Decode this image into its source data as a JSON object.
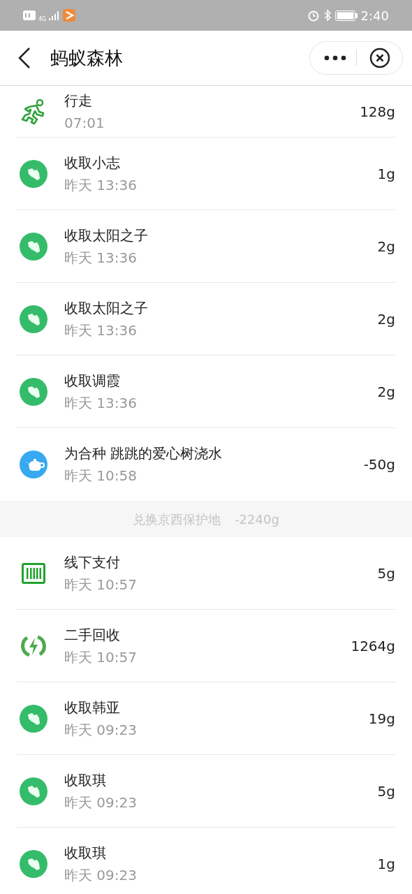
{
  "status_bar": {
    "network": "4G",
    "time": "2:40"
  },
  "header": {
    "title": "蚂蚁森林"
  },
  "records": [
    {
      "kind": "walk",
      "title": "行走",
      "time": "07:01",
      "amount": "128g"
    },
    {
      "kind": "collect",
      "title": "收取小志",
      "time": "昨天 13:36",
      "amount": "1g"
    },
    {
      "kind": "collect",
      "title": "收取太阳之子",
      "time": "昨天 13:36",
      "amount": "2g"
    },
    {
      "kind": "collect",
      "title": "收取太阳之子",
      "time": "昨天 13:36",
      "amount": "2g"
    },
    {
      "kind": "collect",
      "title": "收取调霞",
      "time": "昨天 13:36",
      "amount": "2g"
    },
    {
      "kind": "water",
      "title": "为合种 跳跳的爱心树浇水",
      "time": "昨天 10:58",
      "amount": "-50g"
    },
    {
      "kind": "separator",
      "title": "兑换京西保护地",
      "amount": "-2240g"
    },
    {
      "kind": "pay",
      "title": "线下支付",
      "time": "昨天 10:57",
      "amount": "5g"
    },
    {
      "kind": "recycle",
      "title": "二手回收",
      "time": "昨天 10:57",
      "amount": "1264g"
    },
    {
      "kind": "collect",
      "title": "收取韩亚",
      "time": "昨天 09:23",
      "amount": "19g"
    },
    {
      "kind": "collect",
      "title": "收取琪",
      "time": "昨天 09:23",
      "amount": "5g"
    },
    {
      "kind": "collect",
      "title": "收取琪",
      "time": "昨天 09:23",
      "amount": "1g"
    }
  ]
}
